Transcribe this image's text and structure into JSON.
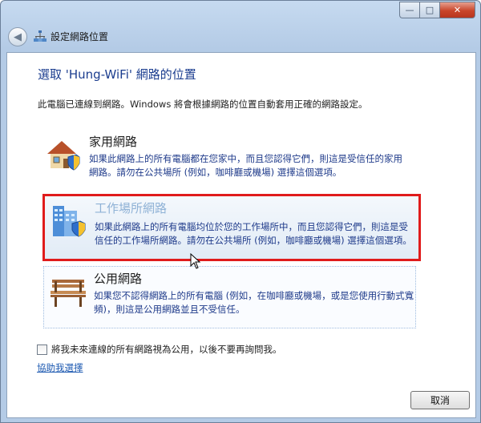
{
  "window": {
    "title": "設定網路位置",
    "controls": {
      "minimize": "—",
      "maximize": "□",
      "close": "✕"
    }
  },
  "main": {
    "heading": "選取 'Hung-WiFi' 網路的位置",
    "description": "此電腦已連線到網路。Windows 將會根據網路的位置自動套用正確的網路設定。"
  },
  "options": [
    {
      "title": "家用網路",
      "text": "如果此網路上的所有電腦都在您家中，而且您認得它們，則這是受信任的家用網路。請勿在公共場所 (例如，咖啡廳或機場) 選擇這個選項。",
      "icon": "house-icon"
    },
    {
      "title": "工作場所網路",
      "text": "如果此網路上的所有電腦均位於您的工作場所中，而且您認得它們，則這是受信任的工作場所網路。請勿在公共場所 (例如，咖啡廳或機場) 選擇這個選項。",
      "icon": "office-building-icon"
    },
    {
      "title": "公用網路",
      "text": "如果您不認得網路上的所有電腦 (例如，在咖啡廳或機場，或是您使用行動式寬頻)，則這是公用網路並且不受信任。",
      "icon": "park-bench-icon"
    }
  ],
  "checkbox": {
    "label": "將我未來連線的所有網路視為公用，以後不要再詢問我。",
    "checked": false
  },
  "help_link": "協助我選擇",
  "footer": {
    "cancel_label": "取消"
  },
  "colors": {
    "highlight_border": "#e01b1b",
    "heading": "#1b3d8f",
    "link": "#1a57b0"
  }
}
